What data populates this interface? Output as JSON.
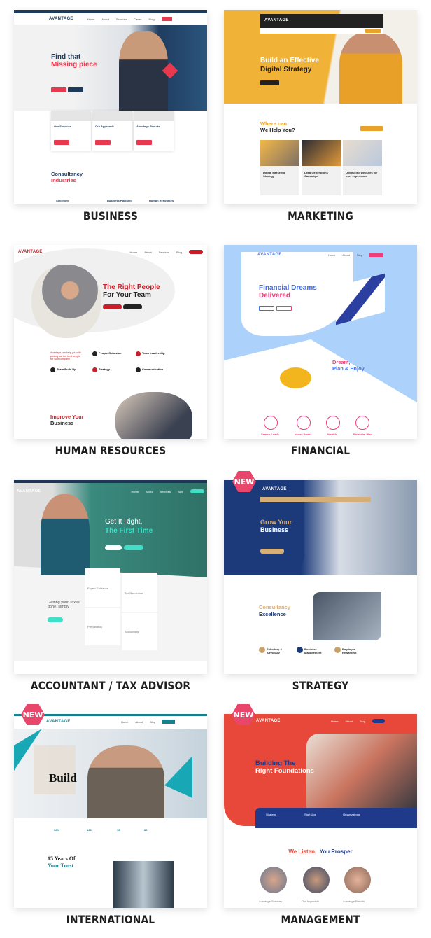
{
  "brand": "AVANTAGE",
  "new_badge": "NEW",
  "demos": [
    {
      "label": "BUSINESS",
      "headline1": "Find that",
      "headline2": "Missing piece",
      "cards": [
        "Our Services",
        "Our Approach",
        "Avantage Results"
      ],
      "section1": "Consultancy",
      "section2": "Industries",
      "items": [
        "Solicitory",
        "Business Planning",
        "Human Resources"
      ],
      "colors": {
        "primary": "#1b3a5c",
        "accent": "#e8394f"
      }
    },
    {
      "label": "MARKETING",
      "headline1": "Build an Effective",
      "headline2": "Digital Strategy",
      "section1": "Where can",
      "section2": "We Help You?",
      "cards": [
        "Digital Marketing Strategy",
        "Lead Generations Campaign",
        "Optimizing websites for user experience"
      ],
      "colors": {
        "primary": "#e9a22a",
        "dark": "#222"
      }
    },
    {
      "label": "HUMAN RESOURCES",
      "headline1": "The Right People",
      "headline2": "For Your Team",
      "intro": "Avantage can help you with picking out the best people for your company",
      "features": [
        "People Cohesion",
        "Team Leadership",
        "Team Build Up",
        "Strategy",
        "Communication"
      ],
      "section1": "Improve Your",
      "section2": "Business",
      "colors": {
        "accent": "#c8202a"
      }
    },
    {
      "label": "FINANCIAL",
      "headline1": "Financial Dreams",
      "headline2": "Delivered",
      "section1": "Dream,",
      "section2": "Plan & Enjoy",
      "circles": [
        "Search Leads",
        "Invest Smart",
        "Wealth",
        "Financial Plan"
      ],
      "colors": {
        "blue": "#3d6ef0",
        "pink": "#f03c78",
        "bg": "#acd2fb"
      }
    },
    {
      "label": "ACCOUNTANT / TAX ADVISOR",
      "headline1": "Get It Right,",
      "headline2": "The First Time",
      "side1": "Getting your Taxes",
      "side2": "done, simply",
      "cards": [
        "Expert Guidance",
        "Tax Resolution",
        "Preparation",
        "Accounting"
      ],
      "colors": {
        "primary": "#3a8a7e",
        "accent": "#40e0c8"
      }
    },
    {
      "label": "STRATEGY",
      "new": true,
      "headline1": "Grow Your",
      "headline2": "Business",
      "section1": "Consultancy",
      "section2": "Excellence",
      "items": [
        "Solicitory & Advocacy",
        "Business Management",
        "Employee Rewarding"
      ],
      "colors": {
        "primary": "#1c3a7a",
        "accent": "#d6ae78"
      }
    },
    {
      "label": "INTERNATIONAL",
      "new": true,
      "headline1": "Build",
      "stats": [
        "98%",
        "130+",
        "15",
        "86"
      ],
      "section1": "15 Years Of",
      "section2": "Your Trust",
      "colors": {
        "accent": "#17a7b5"
      }
    },
    {
      "label": "MANAGEMENT",
      "new": true,
      "headline1": "Building The",
      "headline2": "Right Foundations",
      "strip": [
        "Strategy",
        "Start Ups",
        "Organizations"
      ],
      "section1": "We Listen,",
      "section2": "You Prosper",
      "items": [
        "Avantage Services",
        "Our Approach",
        "Avantage Results"
      ],
      "colors": {
        "primary": "#e8483a",
        "navy": "#1f3a8a"
      }
    }
  ]
}
